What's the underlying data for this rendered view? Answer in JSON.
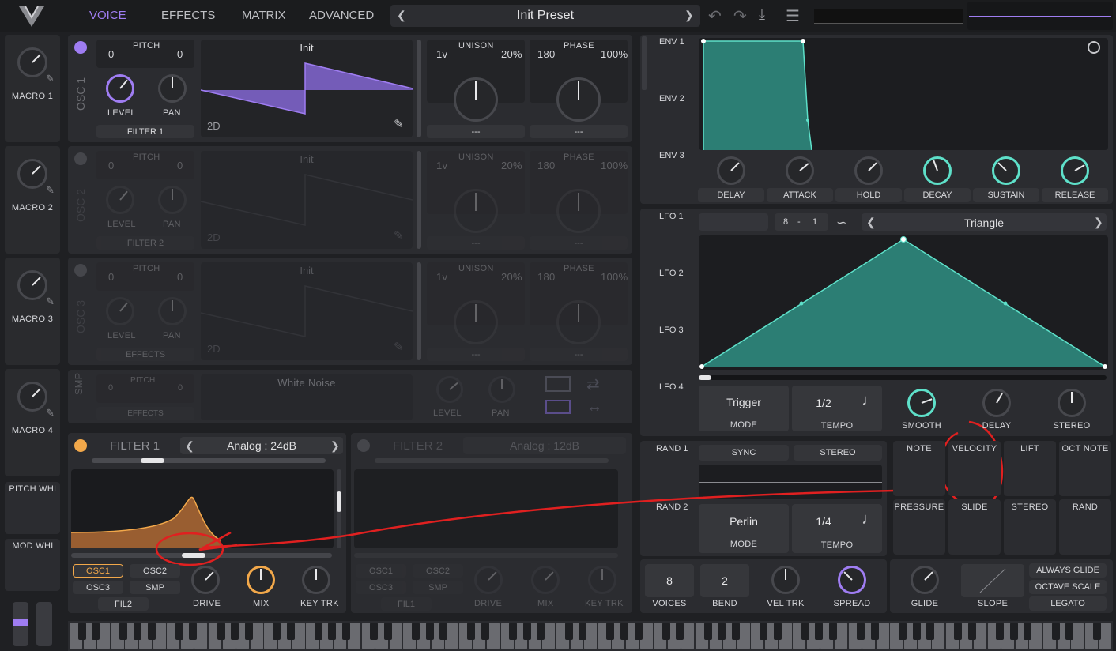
{
  "topbar": {
    "tabs": [
      "VOICE",
      "EFFECTS",
      "MATRIX",
      "ADVANCED"
    ],
    "preset": "Init Preset",
    "logo": "vital-logo-icon"
  },
  "macros": [
    "MACRO 1",
    "MACRO 2",
    "MACRO 3",
    "MACRO 4"
  ],
  "wheels": [
    "PITCH WHL",
    "MOD WHL"
  ],
  "osc": [
    {
      "name": "OSC 1",
      "pitch_l": "0",
      "pitch_r": "0",
      "pitch": "PITCH",
      "wave": "Init",
      "mode": "2D",
      "unison_l": "1v",
      "unison": "UNISON",
      "unison_r": "20%",
      "phase_l": "180",
      "phase": "PHASE",
      "phase_r": "100%",
      "level": "LEVEL",
      "pan": "PAN",
      "dest": "FILTER 1",
      "sel1": "---",
      "sel2": "---"
    },
    {
      "name": "OSC 2",
      "pitch_l": "0",
      "pitch_r": "0",
      "pitch": "PITCH",
      "wave": "Init",
      "mode": "2D",
      "unison_l": "1v",
      "unison": "UNISON",
      "unison_r": "20%",
      "phase_l": "180",
      "phase": "PHASE",
      "phase_r": "100%",
      "level": "LEVEL",
      "pan": "PAN",
      "dest": "FILTER 2",
      "sel1": "---",
      "sel2": "---"
    },
    {
      "name": "OSC 3",
      "pitch_l": "0",
      "pitch_r": "0",
      "pitch": "PITCH",
      "wave": "Init",
      "mode": "2D",
      "unison_l": "1v",
      "unison": "UNISON",
      "unison_r": "20%",
      "phase_l": "180",
      "phase": "PHASE",
      "phase_r": "100%",
      "level": "LEVEL",
      "pan": "PAN",
      "dest": "EFFECTS",
      "sel1": "---",
      "sel2": "---"
    }
  ],
  "smp": {
    "name": "SMP",
    "pitch_l": "0",
    "pitch_r": "0",
    "pitch": "PITCH",
    "dest": "EFFECTS",
    "sample": "White Noise",
    "level": "LEVEL",
    "pan": "PAN"
  },
  "filter1": {
    "name": "FILTER 1",
    "type": "Analog : 24dB",
    "src": [
      "OSC1",
      "OSC2",
      "OSC3",
      "SMP",
      "FIL2"
    ],
    "drive": "DRIVE",
    "mix": "MIX",
    "keytrk": "KEY TRK"
  },
  "filter2": {
    "name": "FILTER 2",
    "type": "Analog : 12dB",
    "src": [
      "OSC1",
      "OSC2",
      "OSC3",
      "SMP",
      "FIL1"
    ],
    "drive": "DRIVE",
    "mix": "MIX",
    "keytrk": "KEY TRK"
  },
  "env": {
    "tabs": [
      "ENV 1",
      "ENV 2",
      "ENV 3"
    ],
    "knobs": [
      "DELAY",
      "ATTACK",
      "HOLD",
      "DECAY",
      "SUSTAIN",
      "RELEASE"
    ]
  },
  "lfo": {
    "tabs": [
      "LFO 1",
      "LFO 2",
      "LFO 3",
      "LFO 4"
    ],
    "grid_l": "8",
    "grid_sep": "-",
    "grid_r": "1",
    "shape": "Triangle",
    "mode_val": "Trigger",
    "mode": "MODE",
    "tempo_val": "1/2",
    "tempo": "TEMPO",
    "knobs": [
      "SMOOTH",
      "DELAY",
      "STEREO"
    ]
  },
  "rand": {
    "tabs": [
      "RAND 1",
      "RAND 2"
    ],
    "sync": "SYNC",
    "stereo": "STEREO",
    "mode_val": "Perlin",
    "mode": "MODE",
    "tempo_val": "1/4",
    "tempo": "TEMPO"
  },
  "mods": [
    "NOTE",
    "VELOCITY",
    "LIFT",
    "OCT NOTE",
    "PRESSURE",
    "SLIDE",
    "STEREO",
    "RAND"
  ],
  "voice": {
    "voices_val": "8",
    "voices": "VOICES",
    "bend_val": "2",
    "bend": "BEND",
    "veltrk": "VEL TRK",
    "spread": "SPREAD"
  },
  "glide": {
    "glide": "GLIDE",
    "slope": "SLOPE",
    "opts": [
      "ALWAYS GLIDE",
      "OCTAVE SCALE",
      "LEGATO"
    ]
  },
  "colors": {
    "accent": "#9f7df2",
    "teal": "#5ee0c9",
    "orange": "#f2a84a",
    "annotation": "#e02020"
  }
}
